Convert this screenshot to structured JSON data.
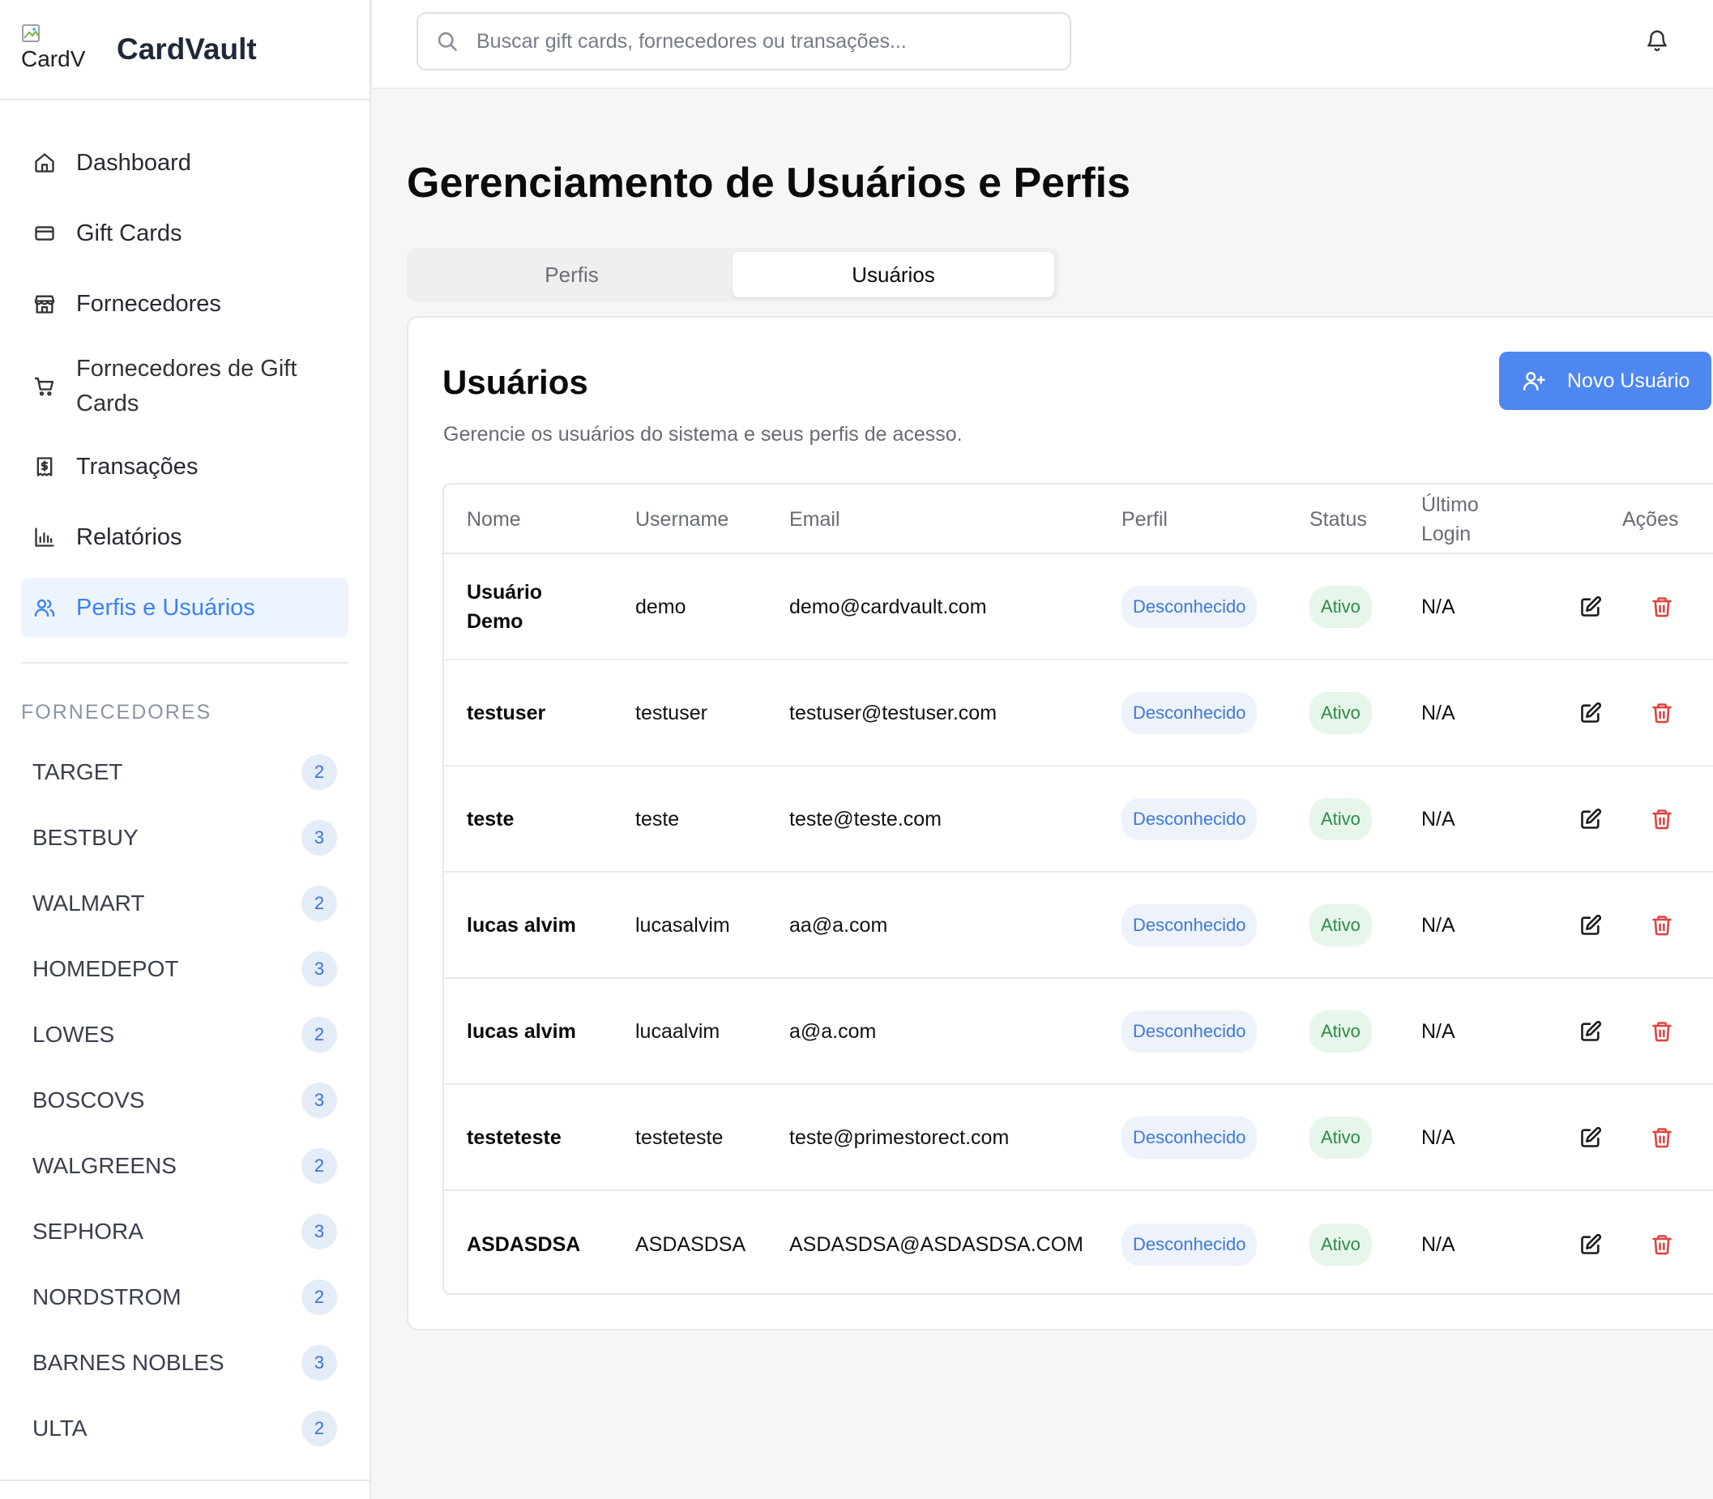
{
  "brand": {
    "name": "CardVault",
    "logo_alt": "CardV"
  },
  "search": {
    "placeholder": "Buscar gift cards, fornecedores ou transações..."
  },
  "nav": [
    {
      "label": "Dashboard",
      "icon": "home-icon"
    },
    {
      "label": "Gift Cards",
      "icon": "credit-card-icon"
    },
    {
      "label": "Fornecedores",
      "icon": "store-icon"
    },
    {
      "label": "Fornecedores de Gift Cards",
      "icon": "shopping-cart-icon"
    },
    {
      "label": "Transações",
      "icon": "receipt-icon"
    },
    {
      "label": "Relatórios",
      "icon": "bar-chart-icon"
    },
    {
      "label": "Perfis e Usuários",
      "icon": "users-icon",
      "active": true
    }
  ],
  "vendors_section": {
    "title": "FORNECEDORES",
    "items": [
      {
        "name": "TARGET",
        "count": "2"
      },
      {
        "name": "BESTBUY",
        "count": "3"
      },
      {
        "name": "WALMART",
        "count": "2"
      },
      {
        "name": "HOMEDEPOT",
        "count": "3"
      },
      {
        "name": "LOWES",
        "count": "2"
      },
      {
        "name": "BOSCOVS",
        "count": "3"
      },
      {
        "name": "WALGREENS",
        "count": "2"
      },
      {
        "name": "SEPHORA",
        "count": "3"
      },
      {
        "name": "NORDSTROM",
        "count": "2"
      },
      {
        "name": "BARNES NOBLES",
        "count": "3"
      },
      {
        "name": "ULTA",
        "count": "2"
      }
    ]
  },
  "page": {
    "title": "Gerenciamento de Usuários e Perfis"
  },
  "tabs": [
    {
      "label": "Perfis",
      "active": false
    },
    {
      "label": "Usuários",
      "active": true
    }
  ],
  "card": {
    "title": "Usuários",
    "description": "Gerencie os usuários do sistema e seus perfis de acesso.",
    "new_button": "Novo Usuário"
  },
  "table": {
    "headers": {
      "nome": "Nome",
      "username": "Username",
      "email": "Email",
      "perfil": "Perfil",
      "status": "Status",
      "ultimo_login": "Último Login",
      "acoes": "Ações"
    },
    "rows": [
      {
        "nome": "Usuário Demo",
        "username": "demo",
        "email": "demo@cardvault.com",
        "perfil": "Desconhecido",
        "status": "Ativo",
        "ultimo_login": "N/A"
      },
      {
        "nome": "testuser",
        "username": "testuser",
        "email": "testuser@testuser.com",
        "perfil": "Desconhecido",
        "status": "Ativo",
        "ultimo_login": "N/A"
      },
      {
        "nome": "teste",
        "username": "teste",
        "email": "teste@teste.com",
        "perfil": "Desconhecido",
        "status": "Ativo",
        "ultimo_login": "N/A"
      },
      {
        "nome": "lucas alvim",
        "username": "lucasalvim",
        "email": "aa@a.com",
        "perfil": "Desconhecido",
        "status": "Ativo",
        "ultimo_login": "N/A"
      },
      {
        "nome": "lucas alvim",
        "username": "lucaalvim",
        "email": "a@a.com",
        "perfil": "Desconhecido",
        "status": "Ativo",
        "ultimo_login": "N/A"
      },
      {
        "nome": "testeteste",
        "username": "testeteste",
        "email": "teste@primestorect.com",
        "perfil": "Desconhecido",
        "status": "Ativo",
        "ultimo_login": "N/A"
      },
      {
        "nome": "ASDASDSA",
        "username": "ASDASDSA",
        "email": "ASDASDSA@ASDASDSA.COM",
        "perfil": "Desconhecido",
        "status": "Ativo",
        "ultimo_login": "N/A"
      }
    ]
  },
  "colors": {
    "accent": "#3b82f6",
    "button": "#4f87f0",
    "active_nav_bg": "#eef4fd",
    "status_green": "#2e8a49",
    "delete_red": "#e0433f"
  }
}
